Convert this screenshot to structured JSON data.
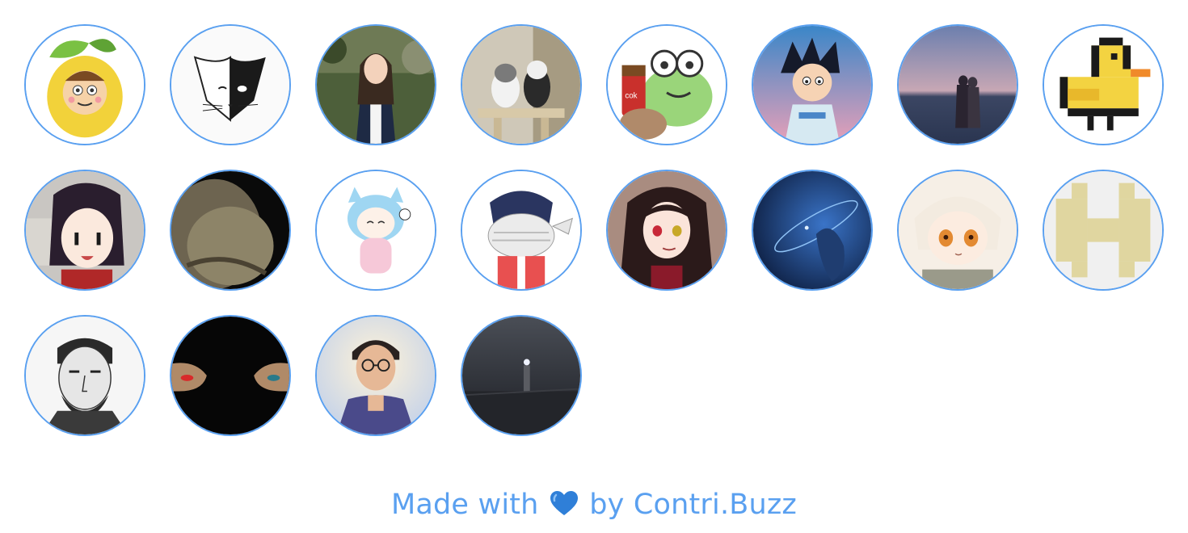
{
  "contributors": [
    {
      "id": "lemon-character",
      "icon": "lemon-character-avatar"
    },
    {
      "id": "black-white-cat",
      "icon": "black-white-cat-avatar"
    },
    {
      "id": "girl-photo",
      "icon": "portrait-photo-avatar"
    },
    {
      "id": "two-cats",
      "icon": "cats-photo-avatar"
    },
    {
      "id": "frog-cola",
      "icon": "frog-sticker-avatar"
    },
    {
      "id": "anime-boy",
      "icon": "anime-boy-avatar"
    },
    {
      "id": "beach-couple",
      "icon": "beach-sunset-avatar"
    },
    {
      "id": "pixel-duck",
      "icon": "pixel-duck-avatar"
    },
    {
      "id": "anime-girl-dark-hair",
      "icon": "anime-girl-avatar"
    },
    {
      "id": "closeup-photo",
      "icon": "closeup-photo-avatar"
    },
    {
      "id": "chibi-blue-cat-girl",
      "icon": "chibi-catgirl-avatar"
    },
    {
      "id": "scarf-chibi",
      "icon": "scarf-chibi-avatar"
    },
    {
      "id": "anime-girl-red-eyes",
      "icon": "anime-girl-red-eyes-avatar"
    },
    {
      "id": "blue-space",
      "icon": "space-scene-avatar"
    },
    {
      "id": "anime-white-hair",
      "icon": "anime-white-hair-avatar"
    },
    {
      "id": "pixel-h",
      "icon": "pixel-h-avatar"
    },
    {
      "id": "sketch-man",
      "icon": "sketch-portrait-avatar"
    },
    {
      "id": "red-blue-pill",
      "icon": "pills-hands-avatar"
    },
    {
      "id": "glasses-man",
      "icon": "glasses-man-avatar"
    },
    {
      "id": "night-lighthouse",
      "icon": "night-lighthouse-avatar"
    }
  ],
  "footer": {
    "prefix": "Made with",
    "heart_icon": "blue-heart-icon",
    "suffix": "by",
    "brand": "Contri.Buzz"
  },
  "colors": {
    "accent": "#5aa0f0",
    "heart": "#2f7fd8",
    "background": "#ffffff"
  }
}
